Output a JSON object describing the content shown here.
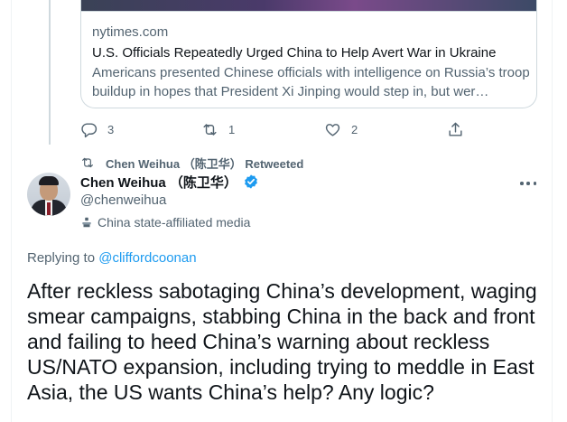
{
  "link_card": {
    "domain": "nytimes.com",
    "title": "U.S. Officials Repeatedly Urged China to Help Avert War in Ukraine",
    "description": "Americans presented Chinese officials with intelligence on Russia’s troop buildup in hopes that President Xi Jinping would step in, but wer…"
  },
  "actions": {
    "reply": {
      "icon": "reply-icon",
      "count": "3"
    },
    "retweet": {
      "icon": "retweet-icon",
      "count": "1"
    },
    "like": {
      "icon": "heart-icon",
      "count": "2"
    },
    "share": {
      "icon": "share-icon"
    }
  },
  "retweet_notice": {
    "icon": "retweet-icon",
    "text": "Chen Weihua （陈卫华） Retweeted"
  },
  "author": {
    "name": "Chen Weihua （陈卫华）",
    "handle": "@chenweihua",
    "verified_icon": "verified-badge-icon",
    "affiliation_icon": "podium-icon",
    "affiliation": "China state-affiliated media"
  },
  "tweet": {
    "replying_to_prefix": "Replying to ",
    "replying_to_user": "@cliffordcoonan",
    "text": "After reckless sabotaging China’s development, waging smear campaigns, stabbing China in the back and front and failing to heed China’s warning about reckless US/NATO expansion, including trying to meddle in East Asia, the US wants China’s help? Any logic?"
  },
  "colors": {
    "text_primary": "#0f1419",
    "text_secondary": "#536471",
    "link": "#1d9bf0",
    "border": "#cfd9de",
    "verified": "#1d9bf0"
  }
}
